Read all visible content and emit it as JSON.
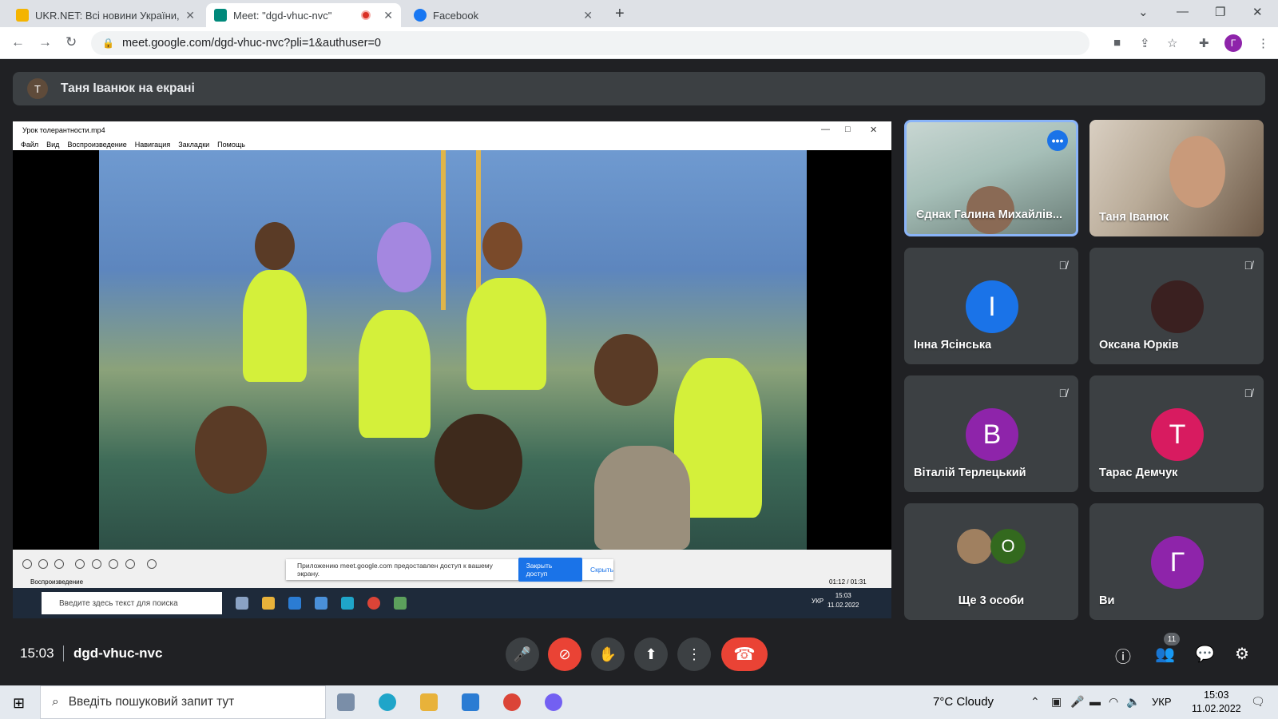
{
  "browser": {
    "tabs": [
      {
        "title": "UKR.NET: Всі новини України, о",
        "active": false,
        "favicon_color": "#f4b400"
      },
      {
        "title": "Meet: \"dgd-vhuc-nvc\"",
        "active": true,
        "favicon_color": "#00897b",
        "recording": true
      },
      {
        "title": "Facebook",
        "active": false,
        "favicon_color": "#1877f2"
      }
    ],
    "new_tab": "+",
    "url": "meet.google.com/dgd-vhuc-nvc?pli=1&authuser=0",
    "profile_initial": "Г"
  },
  "meet": {
    "presenter_banner": {
      "avatar": "T",
      "text": "Таня Іванюк на екрані"
    },
    "shared_screen": {
      "player_title": "Урок толерантности.mp4",
      "player_menu": [
        "Файл",
        "Вид",
        "Воспроизведение",
        "Навигация",
        "Закладки",
        "Помощь"
      ],
      "status": "Воспроизведение",
      "time": "01:12 / 01:31",
      "share_notice": "Приложению meet.google.com предоставлен доступ к вашему экрану.",
      "stop_sharing": "Закрыть доступ",
      "hide": "Скрыть",
      "taskbar_search": "Введите здесь текст для поиска",
      "taskbar_lang": "УКР",
      "taskbar_time": "15:03",
      "taskbar_date": "11.02.2022"
    },
    "participants": [
      {
        "name": "Єднак Галина Михайлів...",
        "type": "camera",
        "muted": false,
        "pinned_menu": true
      },
      {
        "name": "Таня Іванюк",
        "type": "camera",
        "muted": false
      },
      {
        "name": "Інна Ясінська",
        "initial": "I",
        "color": "#1a73e8",
        "muted": true
      },
      {
        "name": "Оксана Юрків",
        "type": "photo",
        "muted": true
      },
      {
        "name": "Віталій Терлецький",
        "initial": "В",
        "color": "#8e24aa",
        "muted": true
      },
      {
        "name": "Тарас Демчук",
        "initial": "T",
        "color": "#d81b60",
        "muted": true
      },
      {
        "name": "Ще 3 особи",
        "initial": "O",
        "color": "#33691e"
      },
      {
        "name": "Ви",
        "initial": "Г",
        "color": "#8e24aa"
      }
    ],
    "bottom_bar": {
      "time": "15:03",
      "meeting_code": "dgd-vhuc-nvc",
      "people_count": "11"
    }
  },
  "os_taskbar": {
    "search_placeholder": "Введіть пошуковий запит тут",
    "weather": "7°C  Cloudy",
    "lang": "УКР",
    "time": "15:03",
    "date": "11.02.2022"
  }
}
